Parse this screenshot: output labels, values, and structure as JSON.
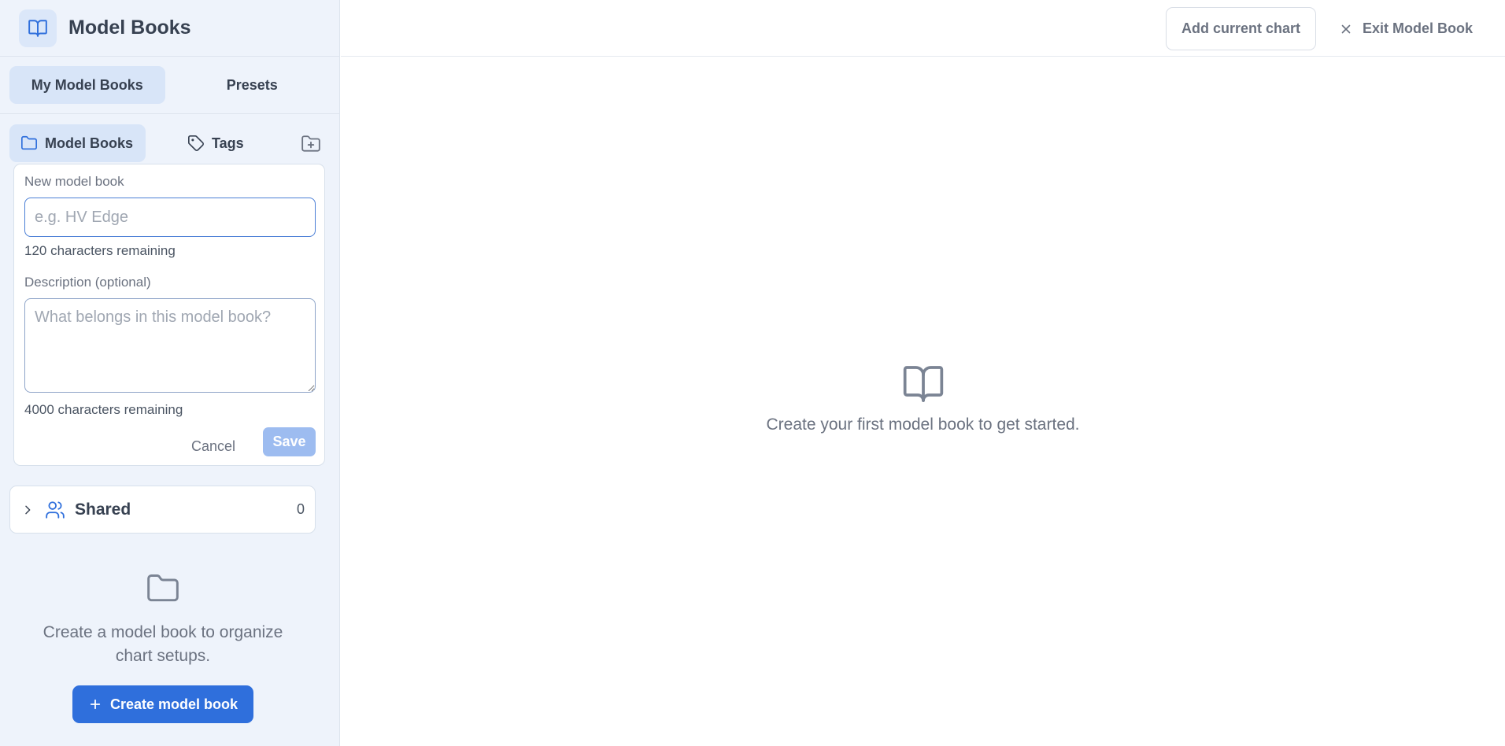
{
  "sidebar": {
    "title": "Model Books",
    "logo_icon": "book-open-icon",
    "top_tabs": [
      {
        "label": "My Model Books",
        "active": true
      },
      {
        "label": "Presets",
        "active": false
      }
    ],
    "sub_tabs": [
      {
        "label": "Model Books",
        "icon": "folder-icon",
        "active": true
      },
      {
        "label": "Tags",
        "icon": "tag-icon",
        "active": false
      }
    ],
    "new_folder_icon": "folder-plus-icon",
    "form": {
      "name_label": "New model book",
      "name_value": "",
      "name_placeholder": "e.g. HV Edge",
      "name_remaining": "120 characters remaining",
      "desc_label": "Description (optional)",
      "desc_value": "",
      "desc_placeholder": "What belongs in this model book?",
      "desc_remaining": "4000 characters remaining",
      "cancel_label": "Cancel",
      "save_label": "Save"
    },
    "shared": {
      "label": "Shared",
      "count": "0",
      "icon": "users-icon"
    },
    "empty_state": {
      "icon": "folder-icon",
      "text": "Create a model book to organize chart setups.",
      "button_label": "Create model book"
    }
  },
  "header": {
    "add_chart_label": "Add current chart",
    "exit_label": "Exit Model Book"
  },
  "main": {
    "empty_icon": "book-open-icon",
    "empty_text": "Create your first model book to get started."
  },
  "colors": {
    "accent": "#2f6fdc",
    "sidebar_bg": "#eef3fb",
    "active_tab_bg": "#d8e5f8",
    "save_disabled": "#9dbcf0"
  }
}
